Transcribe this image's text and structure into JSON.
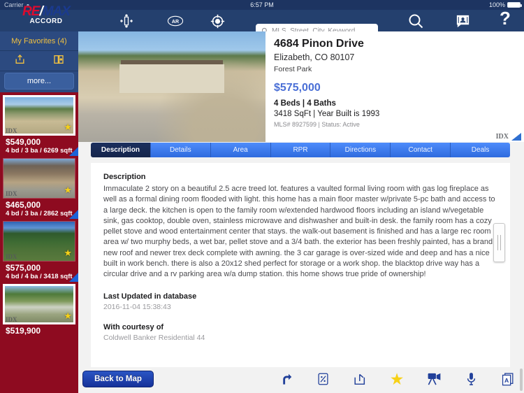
{
  "status_bar": {
    "carrier": "Carrier",
    "wifi_icon": "wifi-icon",
    "time": "6:57 PM",
    "battery_percent": "100%",
    "battery_icon": "battery-full-icon"
  },
  "navbar": {
    "logo_re": "RE",
    "logo_slash": "/",
    "logo_max": "MAX",
    "logo_accord": "ACCORD",
    "icons": [
      {
        "name": "pan-move-icon",
        "glyph": "move"
      },
      {
        "name": "ar-icon",
        "glyph": "AR"
      },
      {
        "name": "locate-target-icon",
        "glyph": "target"
      }
    ],
    "search": {
      "placeholder": "MLS, Street, City, Keyword",
      "value": "",
      "icon": "search-icon"
    },
    "search_button_icon": "magnifier-icon",
    "contacts_button_icon": "contacts-icon",
    "help_button_label": "?"
  },
  "sidebar": {
    "favorites_label": "My Favorites (4)",
    "share_icon": "share-icon",
    "book_icon": "book-icon",
    "more_label": "more...",
    "listings": [
      {
        "price": "$549,000",
        "details": "4 bd / 3 ba / 6269 sqft",
        "idx": "IDX",
        "starred": true
      },
      {
        "price": "$465,000",
        "details": "4 bd / 3 ba / 2862 sqft",
        "idx": "IDX",
        "starred": true
      },
      {
        "price": "$575,000",
        "details": "4 bd / 4 ba / 3418 sqft",
        "idx": "IDX",
        "starred": true
      },
      {
        "price": "$519,900",
        "details": "",
        "idx": "IDX",
        "starred": true
      }
    ]
  },
  "property": {
    "address": "4684 Pinon Drive",
    "city_state_zip": "Elizabeth, CO 80107",
    "subdivision": "Forest Park",
    "price": "$575,000",
    "beds_baths": "4 Beds | 4 Baths",
    "size_year": "3418 SqFt | Year Built is 1993",
    "mls_status": "MLS# 8927599 | Status: Active",
    "idx_watermark": "IDX"
  },
  "tabs": [
    {
      "label": "Description",
      "active": true
    },
    {
      "label": "Details",
      "active": false
    },
    {
      "label": "Area",
      "active": false
    },
    {
      "label": "RPR",
      "active": false
    },
    {
      "label": "Directions",
      "active": false
    },
    {
      "label": "Contact",
      "active": false
    },
    {
      "label": "Deals",
      "active": false
    }
  ],
  "description_panel": {
    "heading": "Description",
    "body": "Immaculate 2 story on a beautiful 2.5 acre treed lot. features a vaulted formal living room with gas log fireplace as well as a formal dining room flooded with light. this home has a main floor master w/private 5-pc bath and access to a large deck. the kitchen is open to the family room w/extended hardwood floors including an island w/vegetable sink, gas cooktop, double oven, stainless microwave and dishwasher and built-in desk. the family room has a cozy pellet stove and wood entertainment center that stays. the walk-out basement is finished and has a large rec room area w/ two murphy beds, a wet bar, pellet stove and a 3/4 bath. the exterior has been freshly painted, has a brand new roof and newer trex deck complete with awning. the 3 car garage is over-sized wide and deep and has a nice built in work bench. there is also a 20x12 shed perfect for storage or a work shop. the blacktop drive way has a circular drive and a rv parking area w/a dump station. this home shows true pride of ownership!",
    "last_updated_label": "Last Updated in database",
    "last_updated_value": "2016-11-04 15:38:43",
    "courtesy_label": "With courtesy of",
    "courtesy_value": "Coldwell Banker Residential 44"
  },
  "bottom_toolbar": {
    "back_label": "Back to Map",
    "icons": [
      {
        "name": "share-arrow-icon"
      },
      {
        "name": "calculator-percent-icon"
      },
      {
        "name": "export-icon"
      },
      {
        "name": "favorite-star-icon"
      },
      {
        "name": "video-camera-icon"
      },
      {
        "name": "microphone-icon"
      },
      {
        "name": "document-a-icon"
      }
    ]
  },
  "colors": {
    "status_bar": "#1d3461",
    "nav_bar": "#24406e",
    "sidebar": "#8e0b20",
    "favorites_header": "#2c4a80",
    "accent_yellow": "#f0c040",
    "price_blue": "#4a6fd6",
    "tab_blue": "#2f6bde",
    "tab_active": "#15254b",
    "star_yellow": "#f7d117",
    "toolbar_icon": "#21409a"
  }
}
